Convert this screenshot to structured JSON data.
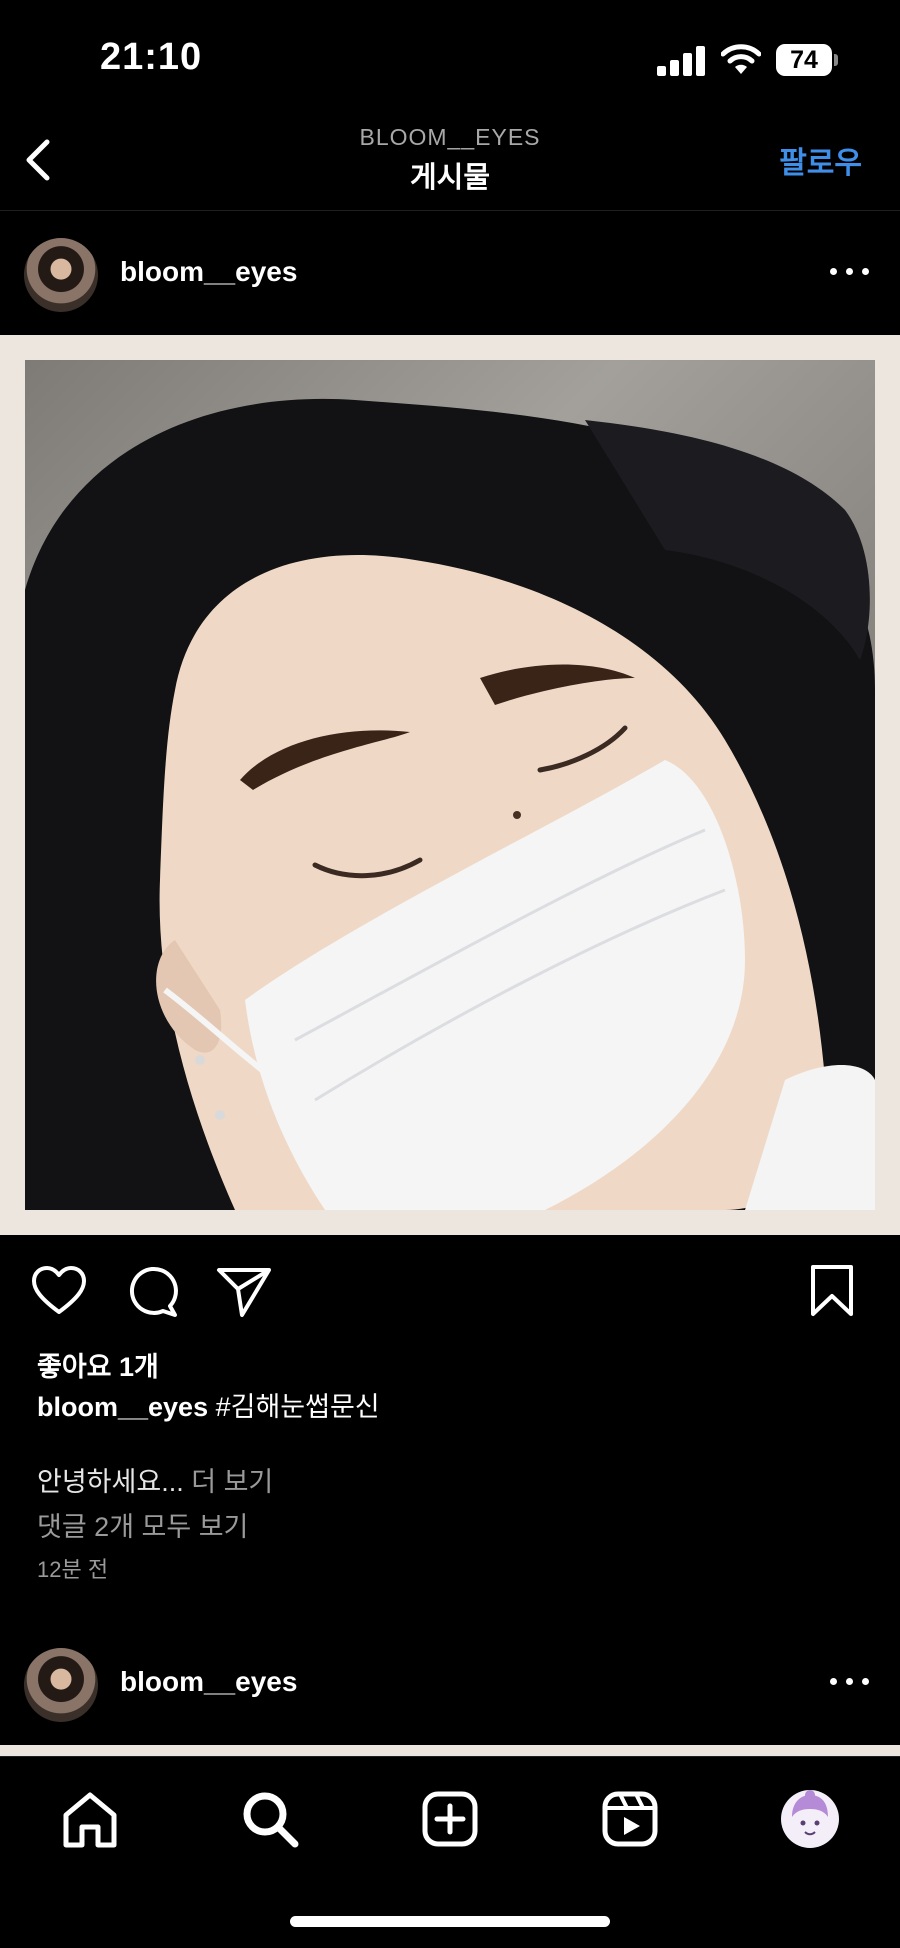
{
  "status_bar": {
    "time": "21:10",
    "battery": "74"
  },
  "header": {
    "subtitle": "BLOOM__EYES",
    "title": "게시물",
    "follow_label": "팔로우"
  },
  "post": {
    "username": "bloom__eyes",
    "likes": "좋아요 1개",
    "caption_user": "bloom__eyes",
    "caption_text": " #김해눈썹문신",
    "caption_preview": "안녕하세요...",
    "more_label": "더 보기",
    "view_comments": "댓글 2개 모두 보기",
    "time_ago": "12분 전"
  },
  "next_post": {
    "username": "bloom__eyes"
  },
  "icons": {
    "back": "chevron-left-icon",
    "more": "more-horizontal-icon",
    "like": "heart-icon",
    "comment": "comment-icon",
    "share": "send-icon",
    "save": "bookmark-icon",
    "home": "home-icon",
    "search": "search-icon",
    "create": "plus-square-icon",
    "reels": "reels-icon",
    "profile": "profile-avatar-icon"
  },
  "colors": {
    "accent": "#3f8fe8",
    "background": "#000000",
    "muted": "#9a9a9a"
  }
}
